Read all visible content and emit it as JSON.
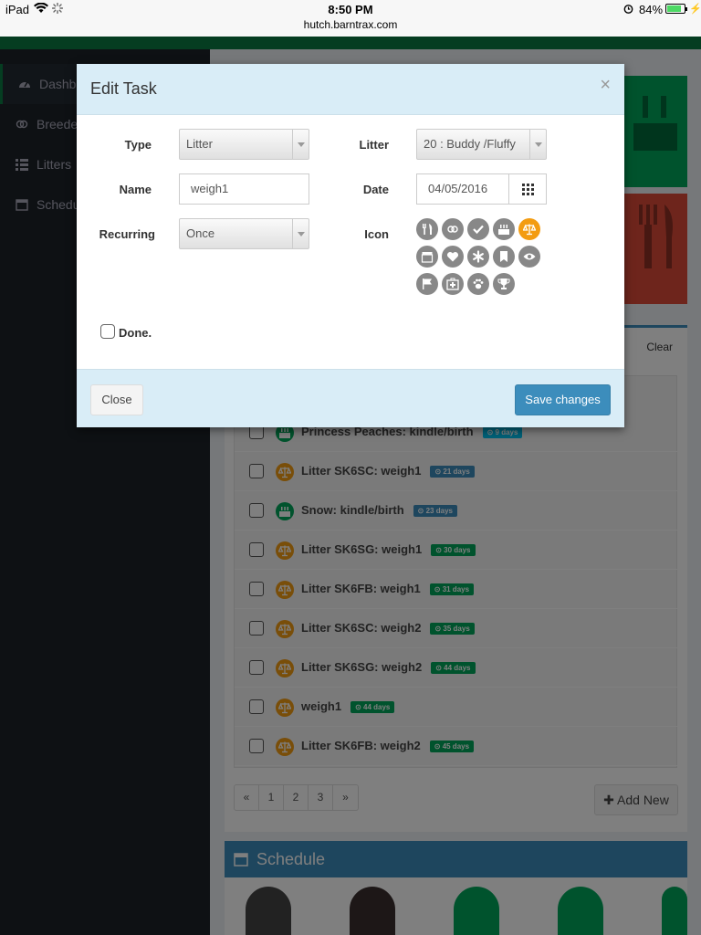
{
  "status_bar": {
    "device": "iPad",
    "time": "8:50 PM",
    "url": "hutch.barntrax.com",
    "battery": "84%",
    "battery_level": 0.84
  },
  "sidebar": {
    "items": [
      {
        "label": "Dashboard",
        "icon": "dashboard-icon"
      },
      {
        "label": "Breeders",
        "icon": "venus-mars-icon"
      },
      {
        "label": "Litters",
        "icon": "grid-icon"
      },
      {
        "label": "Schedule",
        "icon": "calendar-icon"
      }
    ]
  },
  "tasks": {
    "clear_label": "Clear",
    "rows": [
      {
        "text": "Princess Peaches: kindle/birth",
        "badge": "9 days",
        "icon": "birthday-cake-icon",
        "icon_color": "green",
        "badge_color": "lblue"
      },
      {
        "text": "Litter SK6SC: weigh1",
        "badge": "21 days",
        "icon": "balance-scale-icon",
        "icon_color": "orange",
        "badge_color": "blue"
      },
      {
        "text": "Snow: kindle/birth",
        "badge": "23 days",
        "icon": "birthday-cake-icon",
        "icon_color": "green",
        "badge_color": "blue"
      },
      {
        "text": "Litter SK6SG: weigh1",
        "badge": "30 days",
        "icon": "balance-scale-icon",
        "icon_color": "orange",
        "badge_color": "green"
      },
      {
        "text": "Litter SK6FB: weigh1",
        "badge": "31 days",
        "icon": "balance-scale-icon",
        "icon_color": "orange",
        "badge_color": "green"
      },
      {
        "text": "Litter SK6SC: weigh2",
        "badge": "35 days",
        "icon": "balance-scale-icon",
        "icon_color": "orange",
        "badge_color": "green"
      },
      {
        "text": "Litter SK6SG: weigh2",
        "badge": "44 days",
        "icon": "balance-scale-icon",
        "icon_color": "orange",
        "badge_color": "green"
      },
      {
        "text": "weigh1",
        "badge": "44 days",
        "icon": "balance-scale-icon",
        "icon_color": "orange",
        "badge_color": "green"
      },
      {
        "text": "Litter SK6FB: weigh2",
        "badge": "45 days",
        "icon": "balance-scale-icon",
        "icon_color": "orange",
        "badge_color": "green"
      }
    ],
    "pager": [
      "«",
      "1",
      "2",
      "3",
      "»"
    ],
    "add_new_label": "Add New"
  },
  "schedule": {
    "title": "Schedule"
  },
  "modal": {
    "title": "Edit Task",
    "close_symbol": "×",
    "type_label": "Type",
    "type_value": "Litter",
    "litter_label": "Litter",
    "litter_value": "20 : Buddy /Fluffy",
    "name_label": "Name",
    "name_value": "weigh1",
    "date_label": "Date",
    "date_value": "04/05/2016",
    "recurring_label": "Recurring",
    "recurring_value": "Once",
    "icon_label": "Icon",
    "icons": [
      "cutlery-icon",
      "venus-mars-icon",
      "check-icon",
      "birthday-cake-icon",
      "balance-scale-icon",
      "calendar-icon",
      "heart-icon",
      "asterisk-icon",
      "bookmark-icon",
      "eye-icon",
      "flag-icon",
      "medkit-icon",
      "paw-icon",
      "trophy-icon"
    ],
    "selected_icon": "balance-scale-icon",
    "done_label": "Done.",
    "close_button": "Close",
    "save_button": "Save changes"
  },
  "colors": {
    "brand_green": "#0b7a43",
    "primary_blue": "#3c8dbc",
    "modal_header": "#d9edf7",
    "selected_icon": "#f39c12"
  }
}
